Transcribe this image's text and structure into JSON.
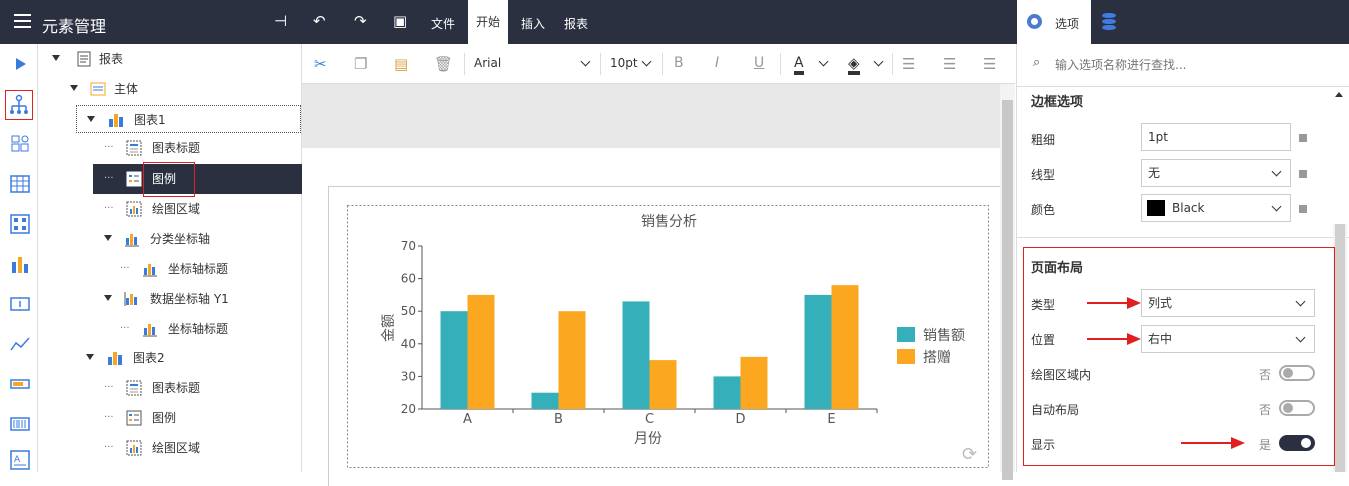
{
  "app": {
    "title": "元素管理"
  },
  "menu": {
    "file": "文件",
    "start": "开始",
    "insert": "插入",
    "report": "报表"
  },
  "options_tab": "选项",
  "toolbar": {
    "font": "Arial",
    "size": "10pt",
    "bold": "B",
    "italic": "I",
    "underline": "U",
    "font_color": "A"
  },
  "tree": {
    "report": "报表",
    "body": "主体",
    "chart1": "图表1",
    "chart_title": "图表标题",
    "legend": "图例",
    "plot_area": "绘图区域",
    "category_axis": "分类坐标轴",
    "axis_title": "坐标轴标题",
    "value_axis": "数据坐标轴 Y1",
    "chart2": "图表2"
  },
  "panel": {
    "search_placeholder": "输入选项名称进行查找...",
    "border_section": "边框选项",
    "thickness_label": "粗细",
    "thickness_value": "1pt",
    "line_label": "线型",
    "line_value": "无",
    "color_label": "颜色",
    "color_value": "Black",
    "layout_section": "页面布局",
    "type_label": "类型",
    "type_value": "列式",
    "position_label": "位置",
    "position_value": "右中",
    "in_plot_label": "绘图区域内",
    "in_plot_value": "否",
    "auto_layout_label": "自动布局",
    "auto_layout_value": "否",
    "show_label": "显示",
    "show_value": "是"
  },
  "colors": {
    "topbar": "#2b3040",
    "teal": "#35b0bb",
    "orange": "#fba720"
  },
  "chart_data": {
    "type": "bar",
    "title": "销售分析",
    "xlabel": "月份",
    "ylabel": "金额",
    "categories": [
      "A",
      "B",
      "C",
      "D",
      "E"
    ],
    "ylim": [
      20,
      70
    ],
    "yticks": [
      20,
      30,
      40,
      50,
      60,
      70
    ],
    "series": [
      {
        "name": "销售额",
        "color": "#35b0bb",
        "values": [
          50,
          25,
          53,
          30,
          55
        ]
      },
      {
        "name": "搭赠",
        "color": "#fba720",
        "values": [
          55,
          50,
          35,
          36,
          58
        ]
      }
    ],
    "legend": "right"
  }
}
